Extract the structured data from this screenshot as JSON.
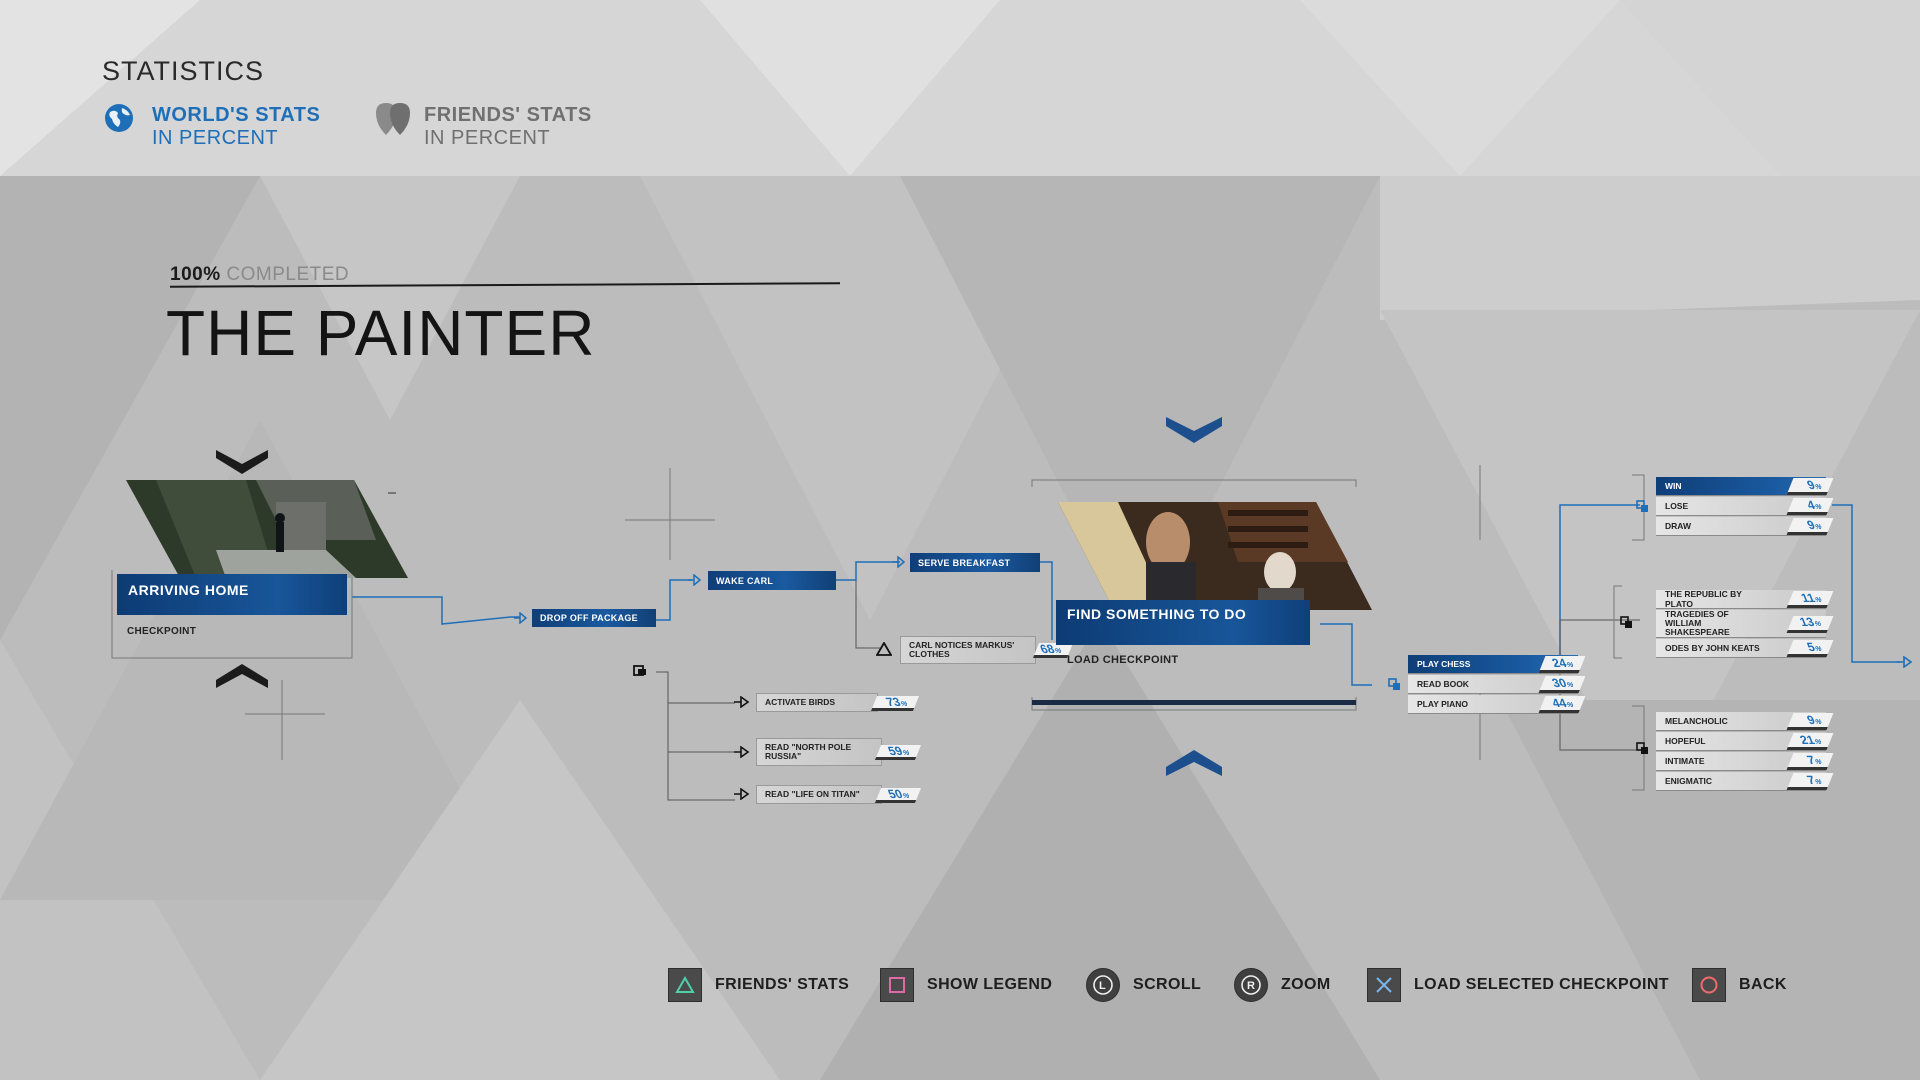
{
  "header": {
    "title": "STATISTICS",
    "world_tab": {
      "label": "WORLD'S STATS",
      "sub": "IN PERCENT",
      "icon": "globe-icon"
    },
    "friends_tab": {
      "label": "FRIENDS' STATS",
      "sub": "IN PERCENT",
      "icon": "friends-icon"
    }
  },
  "chapter": {
    "completion_value": "100%",
    "completion_label": "COMPLETED",
    "title": "THE PAINTER"
  },
  "checkpoints": {
    "arriving_home": {
      "title": "ARRIVING HOME",
      "label": "CHECKPOINT"
    },
    "find_something": {
      "title": "FIND SOMETHING TO DO",
      "label": "LOAD CHECKPOINT"
    }
  },
  "nodes": {
    "drop_off": "DROP OFF PACKAGE",
    "wake_carl": "WAKE CARL",
    "serve_breakfast": "SERVE BREAKFAST",
    "carl_notices": {
      "label": "CARL NOTICES MARKUS' CLOTHES",
      "pct": "68"
    },
    "activate_birds": {
      "label": "ACTIVATE BIRDS",
      "pct": "73"
    },
    "read_north_pole": {
      "label": "READ \"NORTH POLE RUSSIA\"",
      "pct": "59"
    },
    "read_life_titan": {
      "label": "READ \"LIFE ON TITAN\"",
      "pct": "50"
    }
  },
  "activities": [
    {
      "label": "PLAY CHESS",
      "pct": "24",
      "selected": true
    },
    {
      "label": "READ BOOK",
      "pct": "30",
      "selected": false
    },
    {
      "label": "PLAY PIANO",
      "pct": "44",
      "selected": false
    }
  ],
  "chess": [
    {
      "label": "WIN",
      "pct": "9",
      "selected": true
    },
    {
      "label": "LOSE",
      "pct": "4",
      "selected": false
    },
    {
      "label": "DRAW",
      "pct": "9",
      "selected": false
    }
  ],
  "books": [
    {
      "label": "THE REPUBLIC BY PLATO",
      "pct": "11"
    },
    {
      "label": "TRAGEDIES OF WILLIAM SHAKESPEARE",
      "pct": "13"
    },
    {
      "label": "ODES BY JOHN KEATS",
      "pct": "5"
    }
  ],
  "piano": [
    {
      "label": "MELANCHOLIC",
      "pct": "9"
    },
    {
      "label": "HOPEFUL",
      "pct": "21"
    },
    {
      "label": "INTIMATE",
      "pct": "7"
    },
    {
      "label": "ENIGMATIC",
      "pct": "7"
    }
  ],
  "percent_sign": "%",
  "controls": [
    {
      "label": "FRIENDS' STATS",
      "icon": "triangle-button-icon"
    },
    {
      "label": "SHOW LEGEND",
      "icon": "square-button-icon"
    },
    {
      "label": "SCROLL",
      "icon": "left-stick-icon"
    },
    {
      "label": "ZOOM",
      "icon": "right-stick-icon"
    },
    {
      "label": "LOAD SELECTED CHECKPOINT",
      "icon": "cross-button-icon"
    },
    {
      "label": "BACK",
      "icon": "circle-button-icon"
    }
  ],
  "colors": {
    "accent": "#1f6fb8",
    "bar": "#134a8a",
    "background": "#bdbdbd"
  }
}
